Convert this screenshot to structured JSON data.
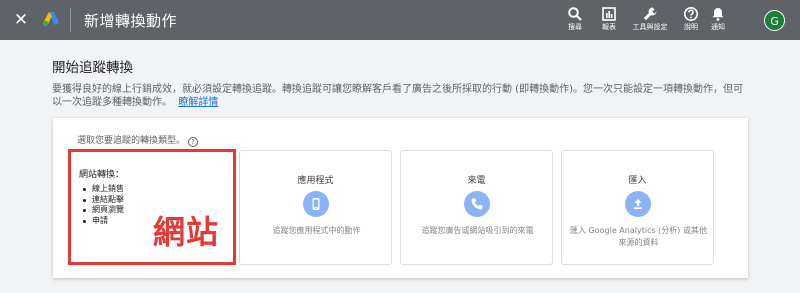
{
  "topbar": {
    "title": "新增轉換動作",
    "tools": [
      {
        "label": "搜尋",
        "icon": "search-icon"
      },
      {
        "label": "報表",
        "icon": "reports-icon"
      },
      {
        "label": "工具與設定",
        "icon": "wrench-icon"
      },
      {
        "label": "說明",
        "icon": "help-icon"
      },
      {
        "label": "通知",
        "icon": "bell-icon"
      }
    ],
    "avatar_initial": "G"
  },
  "page": {
    "title": "開始追蹤轉換",
    "intro": "要獲得良好的線上行銷成效，就必須設定轉換追蹤。轉換追蹤可讓您瞭解客戶看了廣告之後所採取的行動 (即轉換動作)。您一次只能設定一項轉換動作，但可以一次追蹤多種轉換動作。",
    "learn_more": "瞭解詳情"
  },
  "panel": {
    "prompt": "選取您要追蹤的轉換類型。",
    "help_glyph": "?"
  },
  "cards": {
    "website": {
      "heading": "網站轉換：",
      "items": [
        "線上銷售",
        "連結點擊",
        "網頁瀏覽",
        "申請"
      ],
      "overlay_label": "網站"
    },
    "app": {
      "title": "應用程式",
      "icon": "phone-icon",
      "desc": "追蹤您應用程式中的動作"
    },
    "calls": {
      "title": "來電",
      "icon": "call-icon",
      "desc": "追蹤您廣告或網站吸引到的來電"
    },
    "import": {
      "title": "匯入",
      "icon": "upload-icon",
      "desc": "匯入 Google Analytics (分析) 或其他來源的資料"
    }
  },
  "colors": {
    "topbar": "#5f6368",
    "accent_blue": "#1a73e8",
    "icon_circle": "#8ab4f8",
    "highlight_red": "#e53935",
    "avatar_green": "#188038"
  }
}
